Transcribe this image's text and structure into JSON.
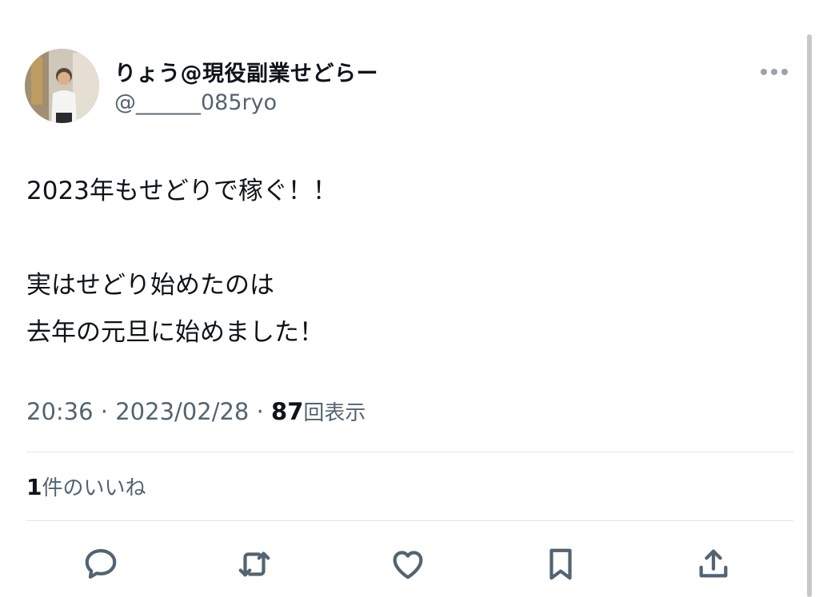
{
  "author": {
    "display_name": "りょう@現役副業せどらー",
    "handle": "@______085ryo",
    "avatar_icon": "avatar-photo"
  },
  "tweet": {
    "lines": [
      "2023年もせどりで稼ぐ！！",
      "",
      "実はせどり始めたのは",
      "去年の元旦に始めました！"
    ]
  },
  "meta": {
    "time": "20:36",
    "separator": " · ",
    "date": "2023/02/28",
    "views_count": "87",
    "views_label": "回表示"
  },
  "likes": {
    "count": "1",
    "label": "件のいいね"
  },
  "actions": [
    {
      "name": "reply",
      "icon": "speech-bubble-icon"
    },
    {
      "name": "retweet",
      "icon": "retweet-icon"
    },
    {
      "name": "like",
      "icon": "heart-icon"
    },
    {
      "name": "bookmark",
      "icon": "bookmark-icon"
    },
    {
      "name": "share",
      "icon": "share-icon"
    }
  ],
  "colors": {
    "text": "#0f1419",
    "secondary": "#536471",
    "icon": "#536471",
    "divider": "#e1e6ea"
  }
}
